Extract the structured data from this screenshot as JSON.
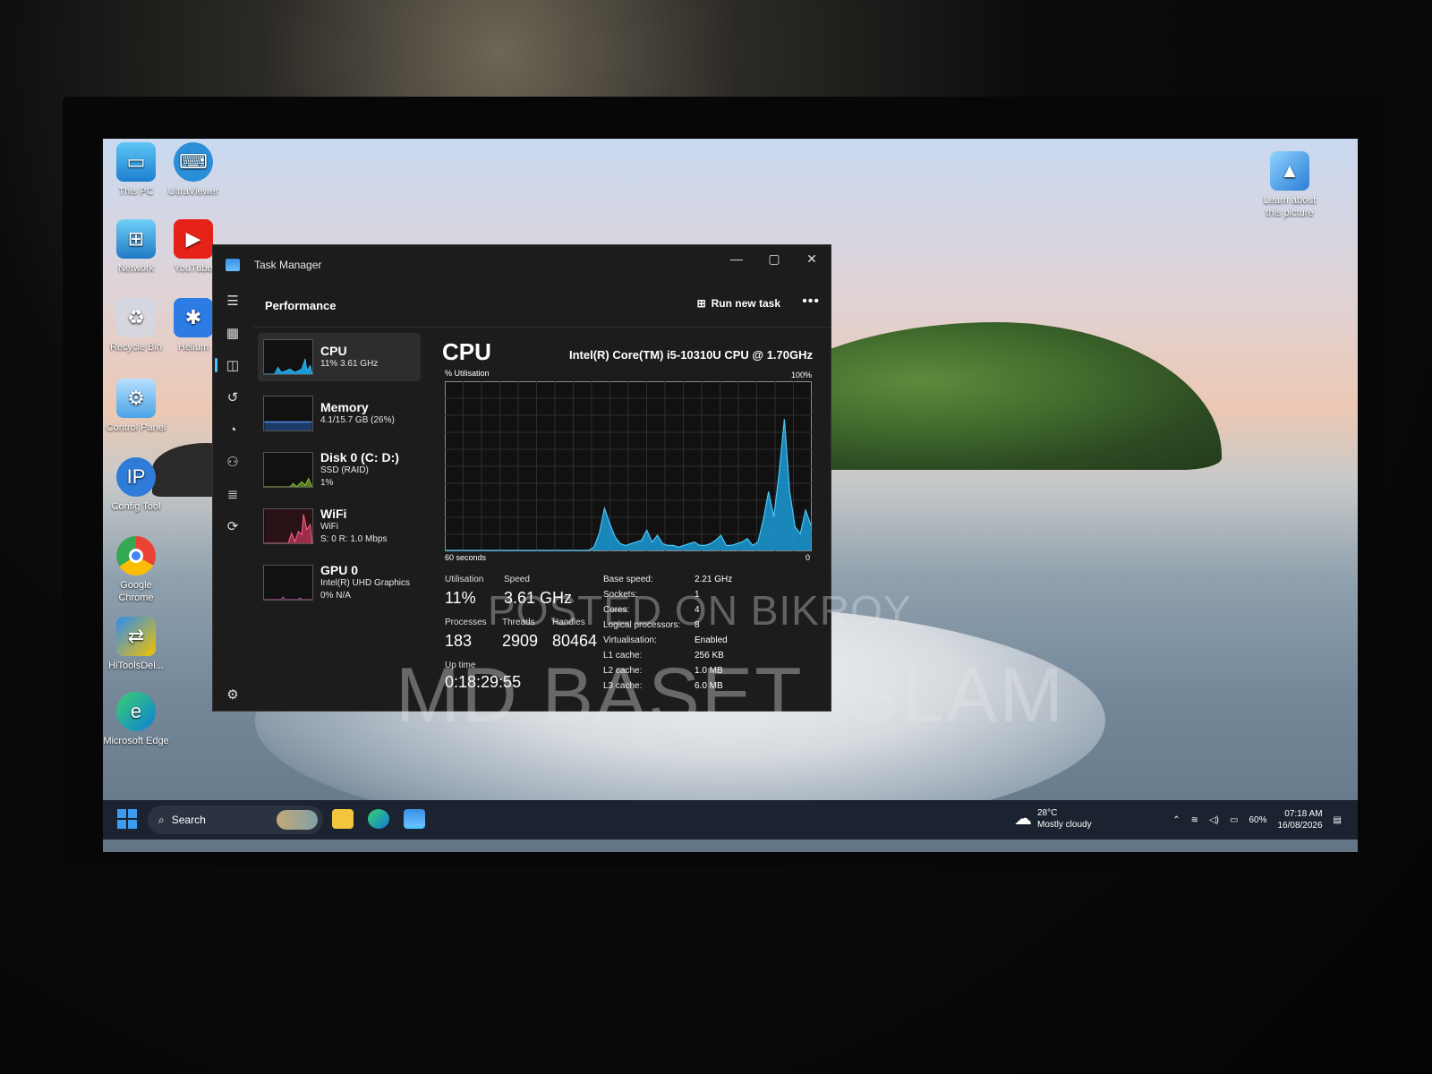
{
  "desktop": {
    "icons": [
      {
        "label": "This PC",
        "icon": "this-pc-icon"
      },
      {
        "label": "UltraViewer",
        "icon": "ultraviewer-icon"
      },
      {
        "label": "Network",
        "icon": "network-icon"
      },
      {
        "label": "YouTube",
        "icon": "youtube-icon"
      },
      {
        "label": "Recycle Bin",
        "icon": "recycle-bin-icon"
      },
      {
        "label": "Helium",
        "icon": "helium-icon"
      },
      {
        "label": "Control Panel",
        "icon": "control-panel-icon"
      },
      {
        "label": "Config Tool",
        "icon": "config-tool-icon"
      },
      {
        "label": "Google Chrome",
        "icon": "chrome-icon"
      },
      {
        "label": "HiToolsDel...",
        "icon": "hitools-icon"
      },
      {
        "label": "Microsoft Edge",
        "icon": "edge-icon"
      },
      {
        "label": "Learn about this picture",
        "icon": "spotlight-icon"
      }
    ]
  },
  "task_manager": {
    "title": "Task Manager",
    "section": "Performance",
    "run_new_task": "Run new task",
    "more": "•••",
    "resources": [
      {
        "name": "CPU",
        "sub1": "11% 3.61 GHz",
        "sub2": "",
        "sub3": ""
      },
      {
        "name": "Memory",
        "sub1": "4.1/15.7 GB (26%)",
        "sub2": "",
        "sub3": ""
      },
      {
        "name": "Disk 0 (C: D:)",
        "sub1": "SSD (RAID)",
        "sub2": "1%",
        "sub3": ""
      },
      {
        "name": "WiFi",
        "sub1": "WiFi",
        "sub2": "S: 0 R: 1.0 Mbps",
        "sub3": ""
      },
      {
        "name": "GPU 0",
        "sub1": "Intel(R) UHD Graphics",
        "sub2": "0% N/A",
        "sub3": ""
      }
    ],
    "cpu": {
      "title": "CPU",
      "model": "Intel(R) Core(TM) i5-10310U CPU @ 1.70GHz",
      "util_label": "% Utilisation",
      "max_label": "100%",
      "time_label": "60 seconds",
      "zero_label": "0",
      "utilisation_label": "Utilisation",
      "utilisation": "11%",
      "speed_label": "Speed",
      "speed": "3.61 GHz",
      "processes_label": "Processes",
      "processes": "183",
      "threads_label": "Threads",
      "threads": "2909",
      "handles_label": "Handles",
      "handles": "80464",
      "uptime_label": "Up time",
      "uptime": "0:18:29:55",
      "specs": [
        {
          "k": "Base speed:",
          "v": "2.21 GHz"
        },
        {
          "k": "Sockets:",
          "v": "1"
        },
        {
          "k": "Cores:",
          "v": "4"
        },
        {
          "k": "Logical processors:",
          "v": "8"
        },
        {
          "k": "Virtualisation:",
          "v": "Enabled"
        },
        {
          "k": "L1 cache:",
          "v": "256 KB"
        },
        {
          "k": "L2 cache:",
          "v": "1.0 MB"
        },
        {
          "k": "L3 cache:",
          "v": "6.0 MB"
        }
      ],
      "history": [
        0,
        0,
        0,
        0,
        0,
        0,
        0,
        0,
        0,
        0,
        0,
        0,
        0,
        0,
        0,
        0,
        0,
        0,
        0,
        0,
        0,
        0,
        0,
        0,
        0,
        0,
        0,
        0,
        2,
        10,
        25,
        16,
        8,
        4,
        3,
        4,
        5,
        6,
        12,
        5,
        9,
        4,
        3,
        3,
        2,
        3,
        4,
        5,
        3,
        3,
        4,
        6,
        9,
        3,
        3,
        4,
        5,
        7,
        3,
        5,
        18,
        35,
        20,
        46,
        78,
        35,
        14,
        10,
        24,
        15
      ],
      "color": "#1a9bd6"
    }
  },
  "taskbar": {
    "search_placeholder": "Search",
    "weather_temp": "28°C",
    "weather_desc": "Mostly cloudy",
    "battery": "60%",
    "time": "07:18 AM",
    "date": "16/08/2026"
  },
  "watermark": {
    "line1": "POSTED ON BIKROY",
    "line2": "MD BASET ISLAM"
  }
}
